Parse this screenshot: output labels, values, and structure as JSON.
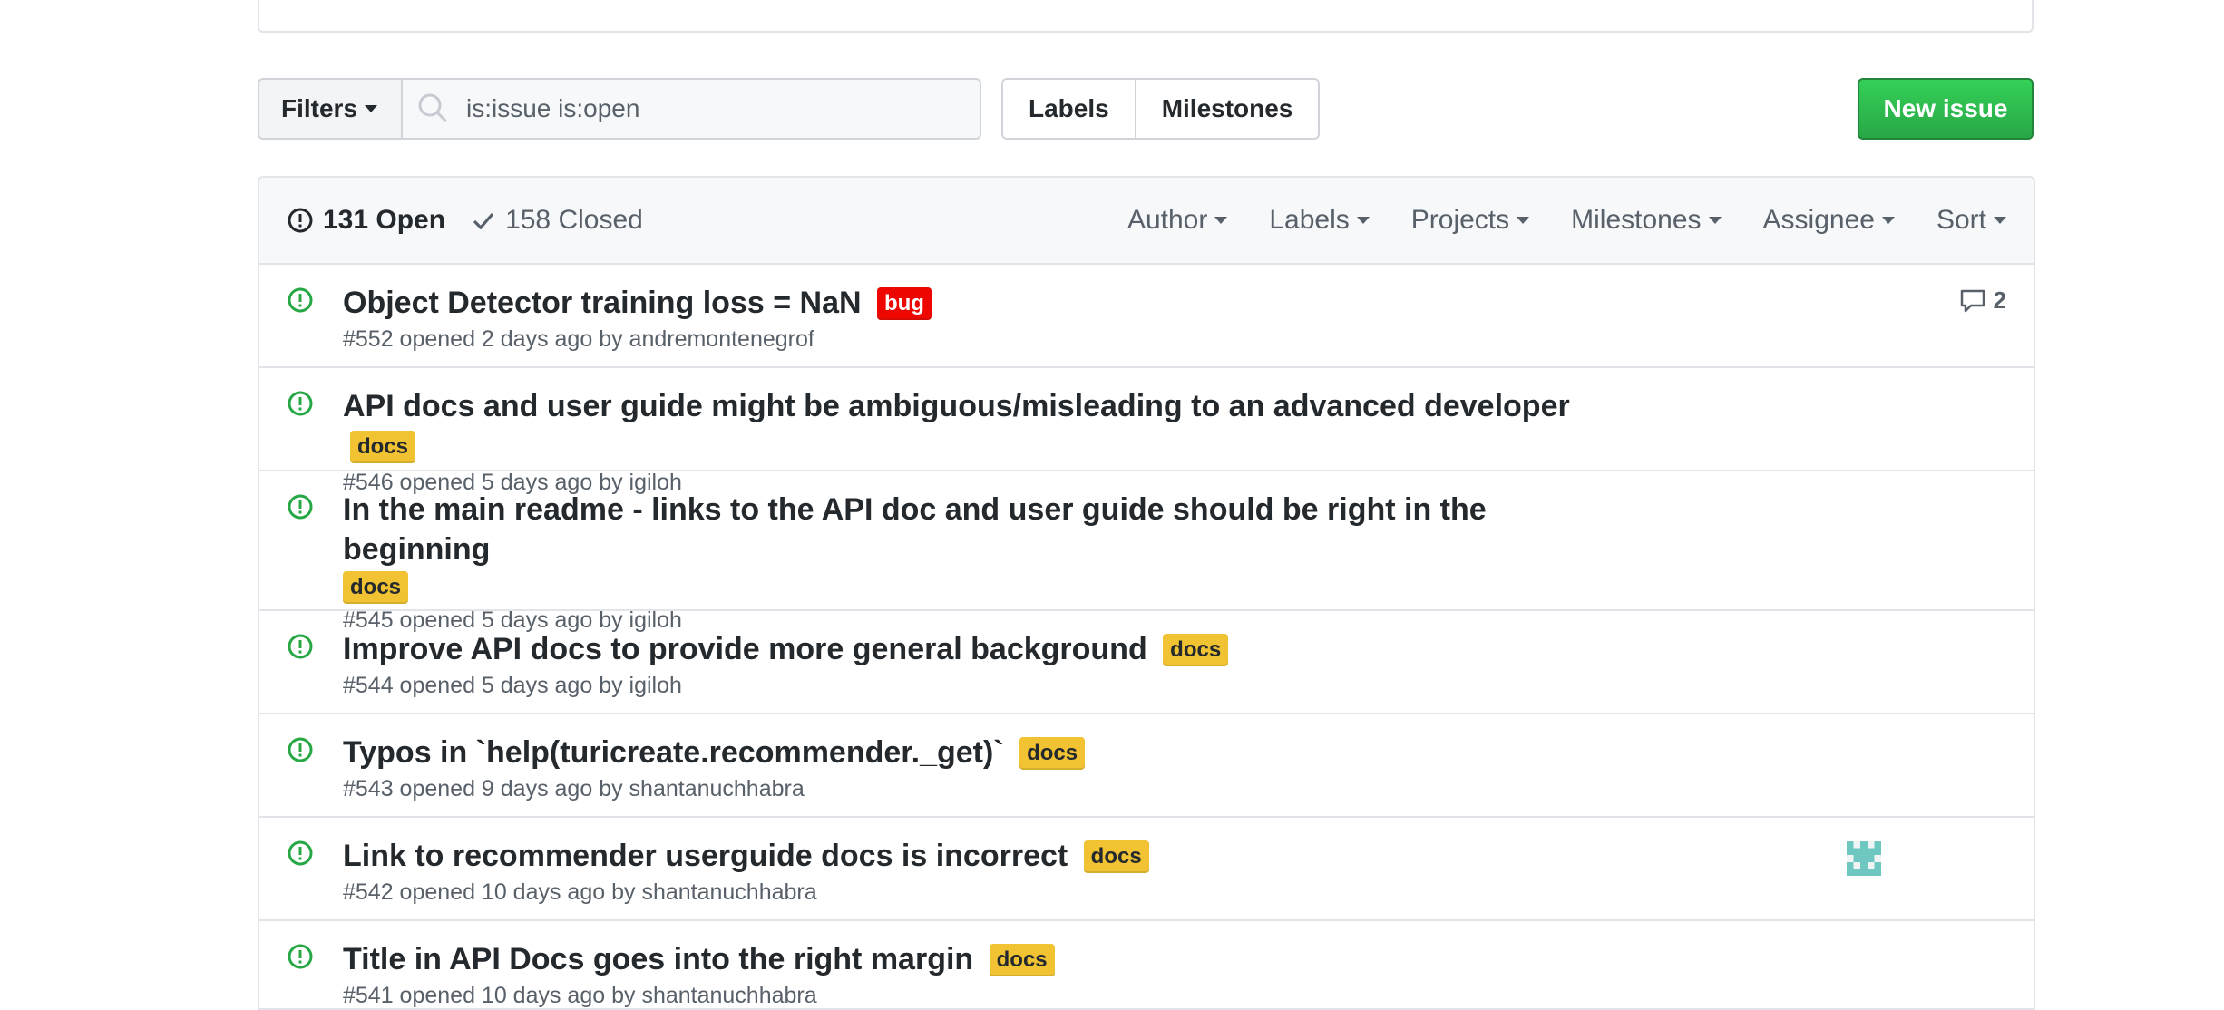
{
  "subnav": {
    "filters_label": "Filters",
    "search_value": "is:issue is:open",
    "labels_label": "Labels",
    "milestones_label": "Milestones",
    "new_issue_label": "New issue"
  },
  "header": {
    "open_label": "131 Open",
    "closed_label": "158 Closed",
    "filters": [
      "Author",
      "Labels",
      "Projects",
      "Milestones",
      "Assignee",
      "Sort"
    ]
  },
  "colors": {
    "open_icon": "#28a745",
    "bug_label_bg": "#ee0701",
    "docs_label_bg": "#f1c232",
    "primary_button": "#28a745"
  },
  "issues": [
    {
      "title": "Object Detector training loss = NaN",
      "label": "bug",
      "meta": "#552 opened 2 days ago by andremontenegrof",
      "comments": "2"
    },
    {
      "title": "API docs and user guide might be ambiguous/misleading to an advanced developer",
      "label": "docs",
      "meta": "#546 opened 5 days ago by igiloh"
    },
    {
      "title": "In the main readme - links to the API doc and user guide should be right in the beginning",
      "label": "docs",
      "meta": "#545 opened 5 days ago by igiloh"
    },
    {
      "title": "Improve API docs to provide more general background",
      "label": "docs",
      "meta": "#544 opened 5 days ago by igiloh"
    },
    {
      "title": "Typos in `help(turicreate.recommender._get)`",
      "label": "docs",
      "meta": "#543 opened 9 days ago by shantanuchhabra"
    },
    {
      "title": "Link to recommender userguide docs is incorrect",
      "label": "docs",
      "meta": "#542 opened 10 days ago by shantanuchhabra"
    },
    {
      "title": "Title in API Docs goes into the right margin",
      "label": "docs",
      "meta": "#541 opened 10 days ago by shantanuchhabra"
    }
  ]
}
